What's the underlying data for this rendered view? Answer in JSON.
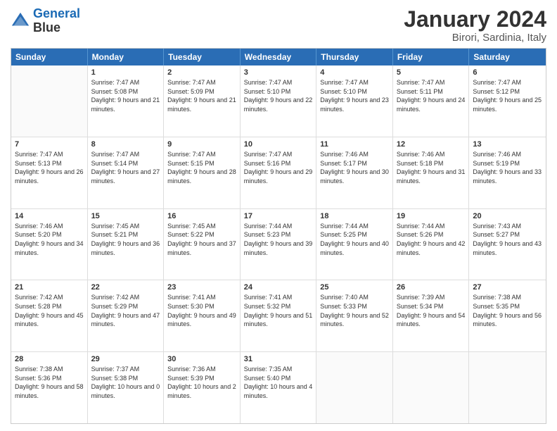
{
  "logo": {
    "line1": "General",
    "line2": "Blue"
  },
  "title": "January 2024",
  "subtitle": "Birori, Sardinia, Italy",
  "header_days": [
    "Sunday",
    "Monday",
    "Tuesday",
    "Wednesday",
    "Thursday",
    "Friday",
    "Saturday"
  ],
  "weeks": [
    [
      {
        "day": "",
        "sunrise": "",
        "sunset": "",
        "daylight": ""
      },
      {
        "day": "1",
        "sunrise": "Sunrise: 7:47 AM",
        "sunset": "Sunset: 5:08 PM",
        "daylight": "Daylight: 9 hours and 21 minutes."
      },
      {
        "day": "2",
        "sunrise": "Sunrise: 7:47 AM",
        "sunset": "Sunset: 5:09 PM",
        "daylight": "Daylight: 9 hours and 21 minutes."
      },
      {
        "day": "3",
        "sunrise": "Sunrise: 7:47 AM",
        "sunset": "Sunset: 5:10 PM",
        "daylight": "Daylight: 9 hours and 22 minutes."
      },
      {
        "day": "4",
        "sunrise": "Sunrise: 7:47 AM",
        "sunset": "Sunset: 5:10 PM",
        "daylight": "Daylight: 9 hours and 23 minutes."
      },
      {
        "day": "5",
        "sunrise": "Sunrise: 7:47 AM",
        "sunset": "Sunset: 5:11 PM",
        "daylight": "Daylight: 9 hours and 24 minutes."
      },
      {
        "day": "6",
        "sunrise": "Sunrise: 7:47 AM",
        "sunset": "Sunset: 5:12 PM",
        "daylight": "Daylight: 9 hours and 25 minutes."
      }
    ],
    [
      {
        "day": "7",
        "sunrise": "Sunrise: 7:47 AM",
        "sunset": "Sunset: 5:13 PM",
        "daylight": "Daylight: 9 hours and 26 minutes."
      },
      {
        "day": "8",
        "sunrise": "Sunrise: 7:47 AM",
        "sunset": "Sunset: 5:14 PM",
        "daylight": "Daylight: 9 hours and 27 minutes."
      },
      {
        "day": "9",
        "sunrise": "Sunrise: 7:47 AM",
        "sunset": "Sunset: 5:15 PM",
        "daylight": "Daylight: 9 hours and 28 minutes."
      },
      {
        "day": "10",
        "sunrise": "Sunrise: 7:47 AM",
        "sunset": "Sunset: 5:16 PM",
        "daylight": "Daylight: 9 hours and 29 minutes."
      },
      {
        "day": "11",
        "sunrise": "Sunrise: 7:46 AM",
        "sunset": "Sunset: 5:17 PM",
        "daylight": "Daylight: 9 hours and 30 minutes."
      },
      {
        "day": "12",
        "sunrise": "Sunrise: 7:46 AM",
        "sunset": "Sunset: 5:18 PM",
        "daylight": "Daylight: 9 hours and 31 minutes."
      },
      {
        "day": "13",
        "sunrise": "Sunrise: 7:46 AM",
        "sunset": "Sunset: 5:19 PM",
        "daylight": "Daylight: 9 hours and 33 minutes."
      }
    ],
    [
      {
        "day": "14",
        "sunrise": "Sunrise: 7:46 AM",
        "sunset": "Sunset: 5:20 PM",
        "daylight": "Daylight: 9 hours and 34 minutes."
      },
      {
        "day": "15",
        "sunrise": "Sunrise: 7:45 AM",
        "sunset": "Sunset: 5:21 PM",
        "daylight": "Daylight: 9 hours and 36 minutes."
      },
      {
        "day": "16",
        "sunrise": "Sunrise: 7:45 AM",
        "sunset": "Sunset: 5:22 PM",
        "daylight": "Daylight: 9 hours and 37 minutes."
      },
      {
        "day": "17",
        "sunrise": "Sunrise: 7:44 AM",
        "sunset": "Sunset: 5:23 PM",
        "daylight": "Daylight: 9 hours and 39 minutes."
      },
      {
        "day": "18",
        "sunrise": "Sunrise: 7:44 AM",
        "sunset": "Sunset: 5:25 PM",
        "daylight": "Daylight: 9 hours and 40 minutes."
      },
      {
        "day": "19",
        "sunrise": "Sunrise: 7:44 AM",
        "sunset": "Sunset: 5:26 PM",
        "daylight": "Daylight: 9 hours and 42 minutes."
      },
      {
        "day": "20",
        "sunrise": "Sunrise: 7:43 AM",
        "sunset": "Sunset: 5:27 PM",
        "daylight": "Daylight: 9 hours and 43 minutes."
      }
    ],
    [
      {
        "day": "21",
        "sunrise": "Sunrise: 7:42 AM",
        "sunset": "Sunset: 5:28 PM",
        "daylight": "Daylight: 9 hours and 45 minutes."
      },
      {
        "day": "22",
        "sunrise": "Sunrise: 7:42 AM",
        "sunset": "Sunset: 5:29 PM",
        "daylight": "Daylight: 9 hours and 47 minutes."
      },
      {
        "day": "23",
        "sunrise": "Sunrise: 7:41 AM",
        "sunset": "Sunset: 5:30 PM",
        "daylight": "Daylight: 9 hours and 49 minutes."
      },
      {
        "day": "24",
        "sunrise": "Sunrise: 7:41 AM",
        "sunset": "Sunset: 5:32 PM",
        "daylight": "Daylight: 9 hours and 51 minutes."
      },
      {
        "day": "25",
        "sunrise": "Sunrise: 7:40 AM",
        "sunset": "Sunset: 5:33 PM",
        "daylight": "Daylight: 9 hours and 52 minutes."
      },
      {
        "day": "26",
        "sunrise": "Sunrise: 7:39 AM",
        "sunset": "Sunset: 5:34 PM",
        "daylight": "Daylight: 9 hours and 54 minutes."
      },
      {
        "day": "27",
        "sunrise": "Sunrise: 7:38 AM",
        "sunset": "Sunset: 5:35 PM",
        "daylight": "Daylight: 9 hours and 56 minutes."
      }
    ],
    [
      {
        "day": "28",
        "sunrise": "Sunrise: 7:38 AM",
        "sunset": "Sunset: 5:36 PM",
        "daylight": "Daylight: 9 hours and 58 minutes."
      },
      {
        "day": "29",
        "sunrise": "Sunrise: 7:37 AM",
        "sunset": "Sunset: 5:38 PM",
        "daylight": "Daylight: 10 hours and 0 minutes."
      },
      {
        "day": "30",
        "sunrise": "Sunrise: 7:36 AM",
        "sunset": "Sunset: 5:39 PM",
        "daylight": "Daylight: 10 hours and 2 minutes."
      },
      {
        "day": "31",
        "sunrise": "Sunrise: 7:35 AM",
        "sunset": "Sunset: 5:40 PM",
        "daylight": "Daylight: 10 hours and 4 minutes."
      },
      {
        "day": "",
        "sunrise": "",
        "sunset": "",
        "daylight": ""
      },
      {
        "day": "",
        "sunrise": "",
        "sunset": "",
        "daylight": ""
      },
      {
        "day": "",
        "sunrise": "",
        "sunset": "",
        "daylight": ""
      }
    ]
  ]
}
